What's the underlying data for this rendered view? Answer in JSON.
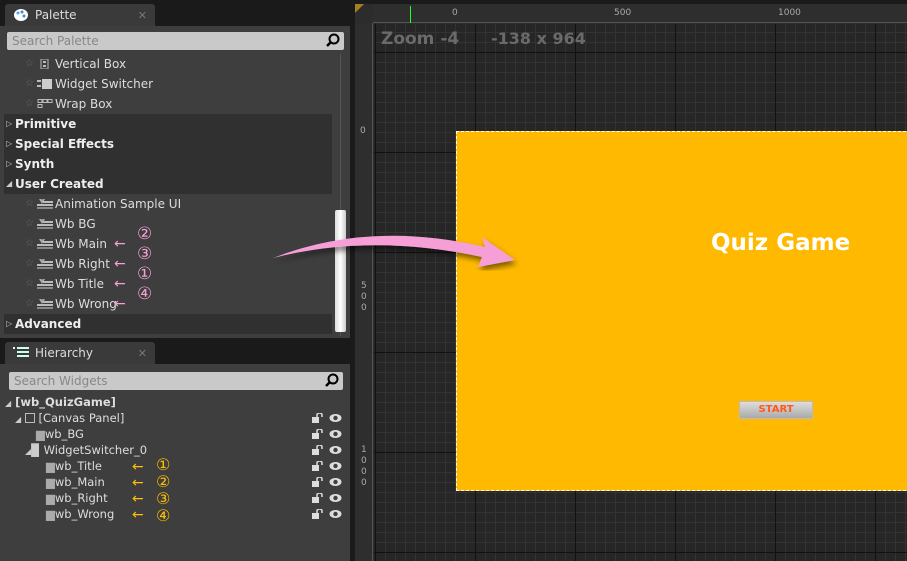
{
  "palette": {
    "tab_title": "Palette",
    "search_placeholder": "Search Palette",
    "items": [
      {
        "label": "Vertical Box",
        "icon": "vertical-box-icon"
      },
      {
        "label": "Widget Switcher",
        "icon": "widget-switcher-icon"
      },
      {
        "label": "Wrap Box",
        "icon": "wrap-box-icon"
      }
    ],
    "categories": [
      "Primitive",
      "Special Effects",
      "Synth",
      "User Created"
    ],
    "user_created": [
      {
        "label": "Animation Sample UI",
        "mark": ""
      },
      {
        "label": "Wb BG",
        "mark": ""
      },
      {
        "label": "Wb Main",
        "mark": "②"
      },
      {
        "label": "Wb Right",
        "mark": "③"
      },
      {
        "label": "Wb Title",
        "mark": "①"
      },
      {
        "label": "Wb Wrong",
        "mark": "④"
      }
    ],
    "advanced": "Advanced"
  },
  "hierarchy": {
    "tab_title": "Hierarchy",
    "search_placeholder": "Search Widgets",
    "root": "[wb_QuizGame]",
    "canvas": "[Canvas Panel]",
    "bg": "wb_BG",
    "switcher": "WidgetSwitcher_0",
    "children": [
      {
        "label": "wb_Title",
        "mark": "①"
      },
      {
        "label": "wb_Main",
        "mark": "②"
      },
      {
        "label": "wb_Right",
        "mark": "③"
      },
      {
        "label": "wb_Wrong",
        "mark": "④"
      }
    ]
  },
  "designer": {
    "zoom": "Zoom -4",
    "resolution": "-138 x 964",
    "ruler_top": [
      "0",
      "500",
      "1000"
    ],
    "ruler_left": [
      "0",
      "500",
      "1000"
    ],
    "title_text": "Quiz Game",
    "start_button": "START"
  },
  "colors": {
    "canvas": "#ffb900",
    "annotation_pink": "#f59fd6",
    "annotation_gold": "#ffc000",
    "start_text": "#ff5a1a"
  },
  "arrow_mark": "←"
}
